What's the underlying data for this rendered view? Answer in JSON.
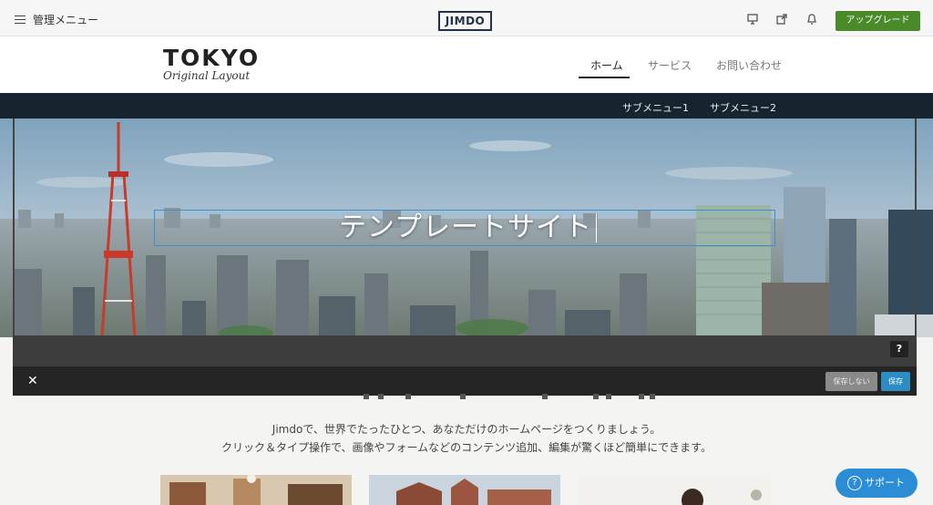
{
  "adminbar": {
    "menu_label": "管理メニュー",
    "logo": "JIMDO",
    "icons": [
      "monitor-icon",
      "share-icon",
      "bell-icon"
    ],
    "upgrade_label": "アップグレード"
  },
  "site": {
    "brand_title": "TOKYO",
    "brand_subtitle": "Original Layout",
    "nav": [
      {
        "label": "ホーム",
        "active": true
      },
      {
        "label": "サービス",
        "active": false
      },
      {
        "label": "お問い合わせ",
        "active": false
      }
    ],
    "subnav": [
      "サブメニュー1",
      "サブメニュー2"
    ]
  },
  "hero": {
    "title": "テンプレートサイト"
  },
  "editor": {
    "help": "?",
    "close": "✕",
    "dont_save_label": "保存しない",
    "save_label": "保存"
  },
  "content": {
    "line1": "Jimdoで、世界でたったひとつ、あなただけのホームページをつくりましょう。",
    "line2": "クリック＆タイプ操作で、画像やフォームなどのコンテンツ追加、編集が驚くほど簡単にできます。"
  },
  "support": {
    "label": "サポート"
  },
  "colors": {
    "upgrade": "#4a8a2b",
    "subbar": "#17242f",
    "save": "#2b8dc3",
    "support": "#2b8dd6",
    "title_outline": "#3a8fd0"
  }
}
